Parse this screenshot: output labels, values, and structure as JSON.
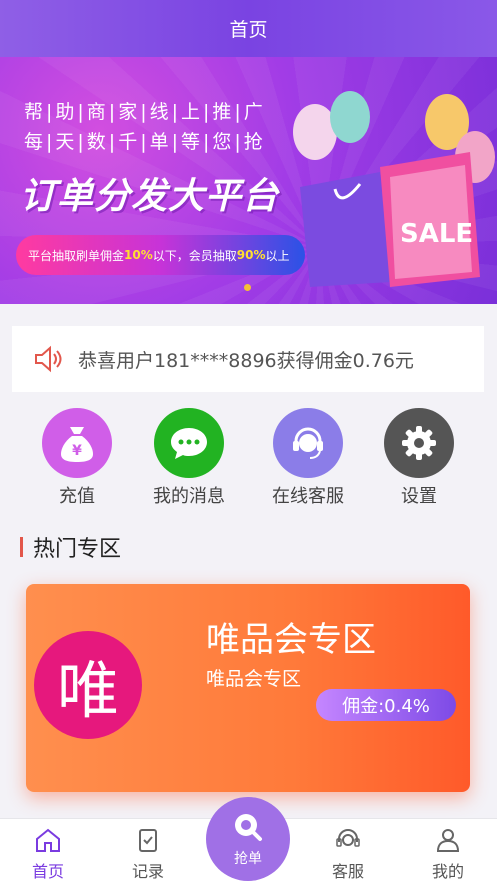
{
  "header": {
    "title": "首页"
  },
  "banner": {
    "line1": "帮|助|商|家|线|上|推|广",
    "line2": "每|天|数|千|单|等|您|抢",
    "title": "订单分发大平台",
    "promo_pre": "平台抽取刷单佣金",
    "promo_hl1": "10%",
    "promo_mid": "以下，会员抽取",
    "promo_hl2": "90%",
    "promo_post": "以上",
    "sale": "SALE"
  },
  "notice": {
    "text": "恭喜用户181****8896获得佣金0.76元",
    "icon": "speaker-icon"
  },
  "menu": [
    {
      "label": "充值",
      "icon": "money-bag-icon",
      "color": "#d05ee8"
    },
    {
      "label": "我的消息",
      "icon": "chat-icon",
      "color": "#22b322"
    },
    {
      "label": "在线客服",
      "icon": "headset-icon",
      "color": "#8b7de8"
    },
    {
      "label": "设置",
      "icon": "gear-icon",
      "color": "#555555"
    }
  ],
  "section": {
    "title": "热门专区"
  },
  "card": {
    "logo_char": "唯",
    "title": "唯品会专区",
    "subtitle": "唯品会专区",
    "commission": "佣金:0.4%"
  },
  "tabbar": {
    "items": [
      {
        "label": "首页",
        "icon": "home-icon",
        "active": true
      },
      {
        "label": "记录",
        "icon": "clipboard-icon",
        "active": false
      },
      {
        "label": "抢单",
        "icon": "grab-order-icon",
        "active": false
      },
      {
        "label": "客服",
        "icon": "headset-icon",
        "active": false
      },
      {
        "label": "我的",
        "icon": "user-icon",
        "active": false
      }
    ]
  }
}
